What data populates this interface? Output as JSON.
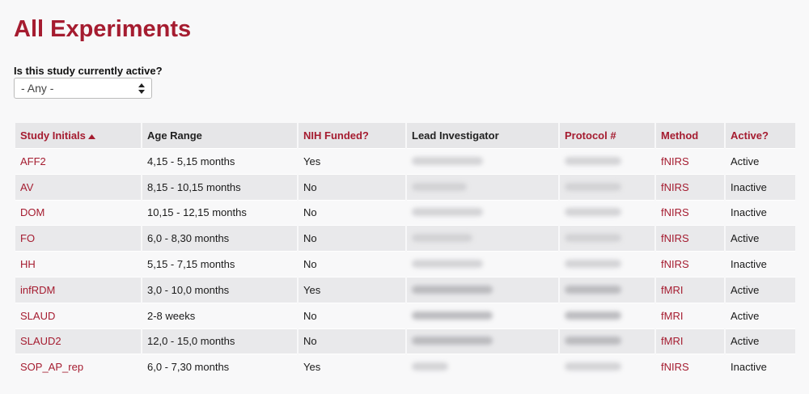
{
  "page": {
    "title": "All Experiments"
  },
  "filter": {
    "label": "Is this study currently active?",
    "selected": "- Any -"
  },
  "table": {
    "headers": {
      "study_initials": "Study Initials",
      "age_range": "Age Range",
      "nih_funded": "NIH Funded?",
      "lead_investigator": "Lead Investigator",
      "protocol": "Protocol #",
      "method": "Method",
      "active": "Active?"
    },
    "rows": [
      {
        "initials": "AFF2",
        "age": "4,15 - 5,15 months",
        "nih": "Yes",
        "method": "fNIRS",
        "active": "Active"
      },
      {
        "initials": "AV",
        "age": "8,15 - 10,15 months",
        "nih": "No",
        "method": "fNIRS",
        "active": "Inactive"
      },
      {
        "initials": "DOM",
        "age": "10,15 - 12,15 months",
        "nih": "No",
        "method": "fNIRS",
        "active": "Inactive"
      },
      {
        "initials": "FO",
        "age": "6,0 - 8,30 months",
        "nih": "No",
        "method": "fNIRS",
        "active": "Active"
      },
      {
        "initials": "HH",
        "age": "5,15 - 7,15 months",
        "nih": "No",
        "method": "fNIRS",
        "active": "Inactive"
      },
      {
        "initials": "infRDM",
        "age": "3,0 - 10,0 months",
        "nih": "Yes",
        "method": "fMRI",
        "active": "Active"
      },
      {
        "initials": "SLAUD",
        "age": "2-8 weeks",
        "nih": "No",
        "method": "fMRI",
        "active": "Active"
      },
      {
        "initials": "SLAUD2",
        "age": "12,0 - 15,0 months",
        "nih": "No",
        "method": "fMRI",
        "active": "Active"
      },
      {
        "initials": "SOP_AP_rep",
        "age": "6,0 - 7,30 months",
        "nih": "Yes",
        "method": "fNIRS",
        "active": "Inactive"
      }
    ]
  },
  "colors": {
    "accent": "#a51c30",
    "header_bg": "#e6e6e8",
    "row_alt_bg": "#e9e9eb"
  }
}
